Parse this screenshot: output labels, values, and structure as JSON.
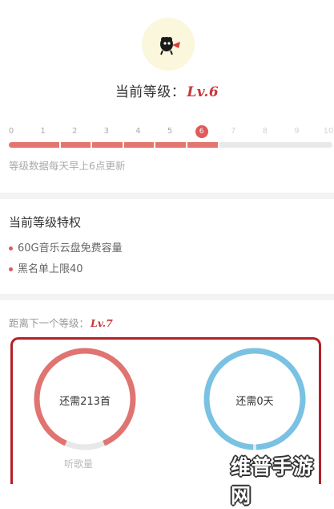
{
  "profile": {
    "level_label": "当前等级：",
    "level_value": "Lv.6"
  },
  "level_bar": {
    "ticks": [
      "0",
      "1",
      "2",
      "3",
      "4",
      "5",
      "6",
      "7",
      "8",
      "9",
      "10"
    ],
    "current_index": 6,
    "note": "等级数据每天早上6点更新"
  },
  "privileges": {
    "heading": "当前等级特权",
    "items": [
      "60G音乐云盘免费容量",
      "黑名单上限40"
    ]
  },
  "next_level": {
    "label": "距离下一个等级：",
    "value": "Lv.7",
    "songs": {
      "text": "还需213首",
      "caption": "听歌量",
      "progress": 0.87,
      "color": "#e07470"
    },
    "days": {
      "text": "还需0天",
      "progress": 1.0,
      "color": "#79c2e3"
    }
  },
  "watermark": "维普手游网",
  "colors": {
    "accent": "#e05a5a",
    "box_border": "#b32127"
  }
}
